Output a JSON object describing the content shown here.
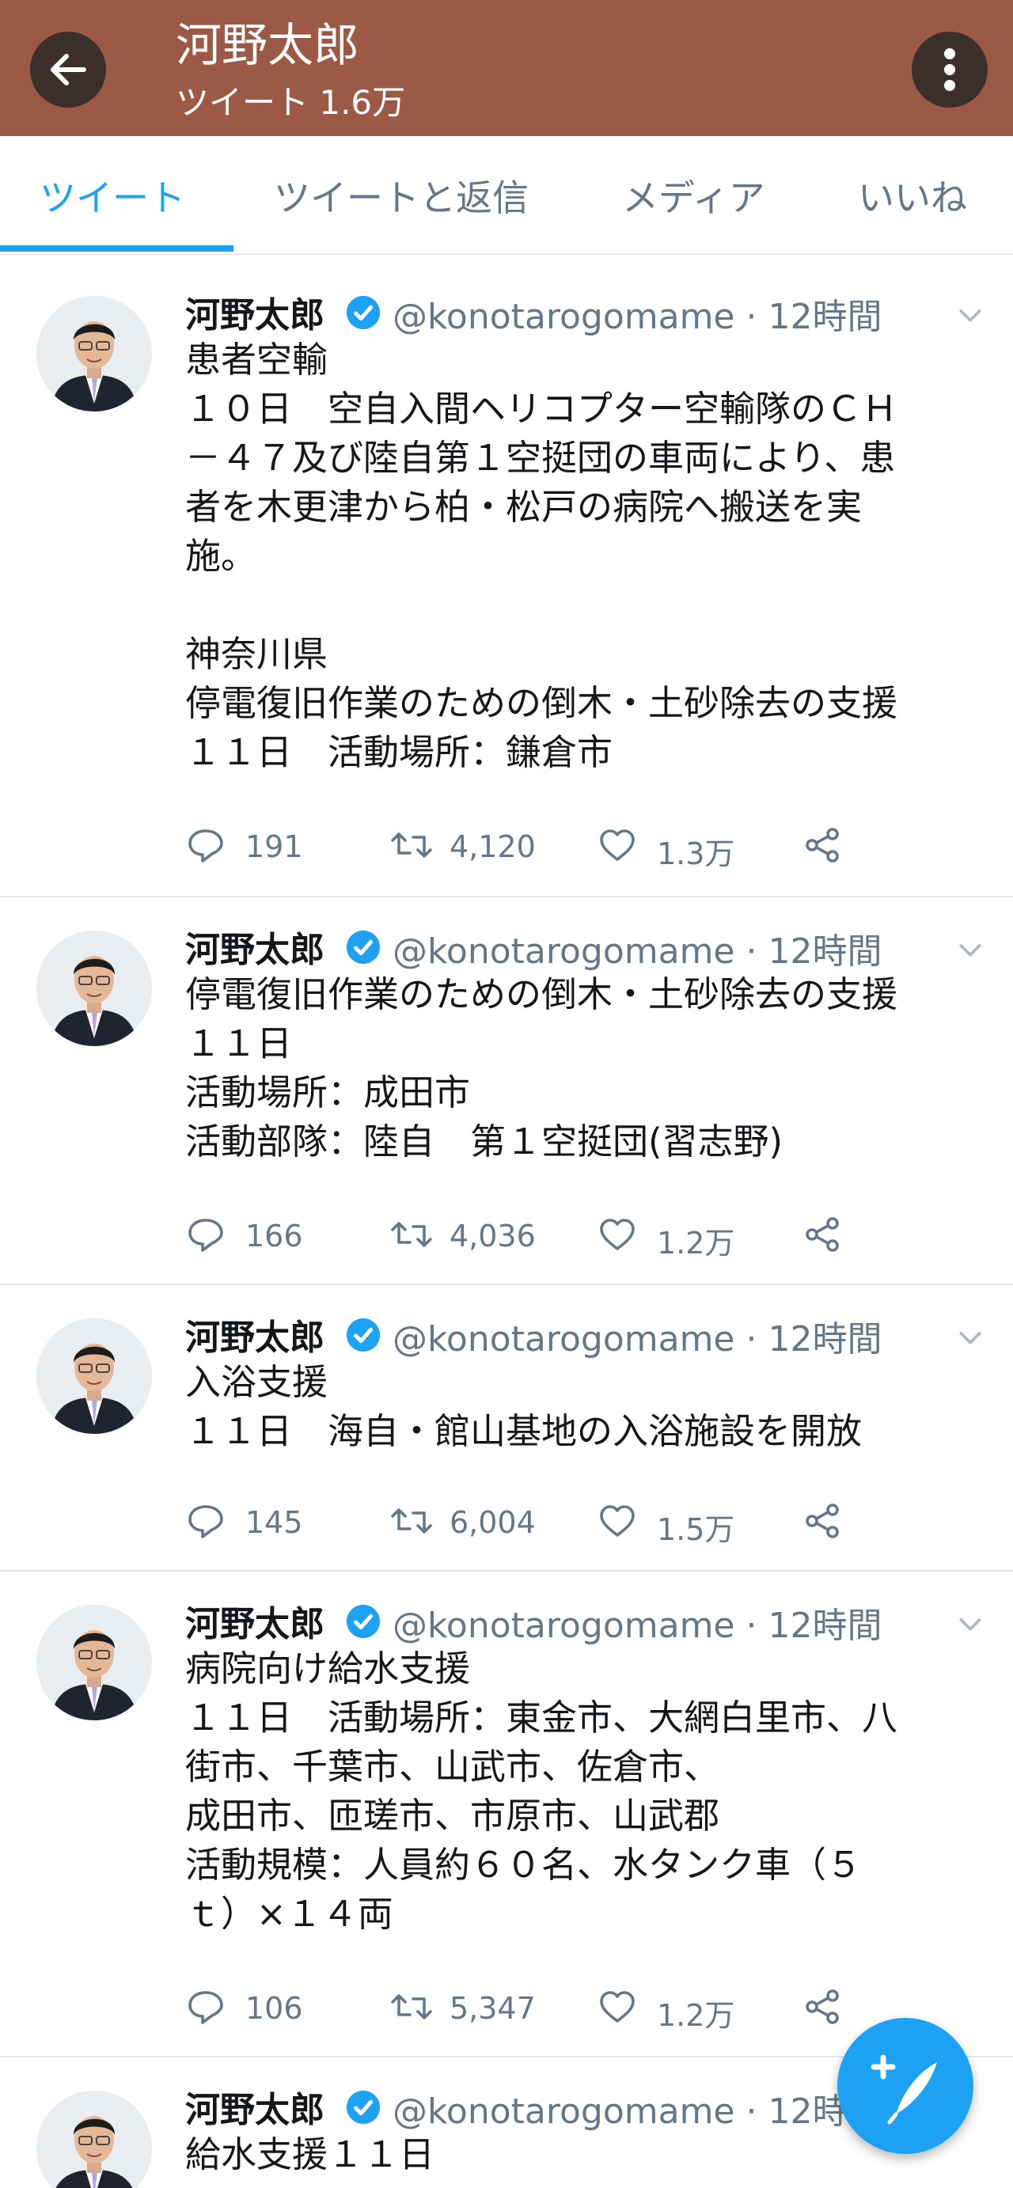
{
  "header": {
    "title": "河野太郎",
    "subtitle": "ツイート 1.6万",
    "bg_color": "#9c5a46"
  },
  "tabs": [
    {
      "label": "ツイート",
      "active": true
    },
    {
      "label": "ツイートと返信",
      "active": false
    },
    {
      "label": "メディア",
      "active": false
    },
    {
      "label": "いいね",
      "active": false
    }
  ],
  "accent_color": "#1da1f2",
  "tweets": [
    {
      "name": "河野太郎",
      "handle": "@konotarogomame · 12時間",
      "text": "患者空輸\n１０日　空自入間ヘリコプター空輸隊のＣＨ\n－４７及び陸自第１空挺団の車両により、患\n者を木更津から柏・松戸の病院へ搬送を実\n施。\n\n神奈川県\n停電復旧作業のための倒木・土砂除去の支援\n１１日　活動場所：鎌倉市",
      "replies": "191",
      "retweets": "4,120",
      "likes": "1.3万"
    },
    {
      "name": "河野太郎",
      "handle": "@konotarogomame · 12時間",
      "text": "停電復旧作業のための倒木・土砂除去の支援\n１１日\n活動場所：成田市\n活動部隊：陸自　第１空挺団(習志野)",
      "replies": "166",
      "retweets": "4,036",
      "likes": "1.2万"
    },
    {
      "name": "河野太郎",
      "handle": "@konotarogomame · 12時間",
      "text": "入浴支援\n１１日　海自・館山基地の入浴施設を開放",
      "replies": "145",
      "retweets": "6,004",
      "likes": "1.5万"
    },
    {
      "name": "河野太郎",
      "handle": "@konotarogomame · 12時間",
      "text": "病院向け給水支援\n１１日　活動場所：東金市、大網白里市、八\n街市、千葉市、山武市、佐倉市、\n成田市、匝瑳市、市原市、山武郡\n活動規模：人員約６０名、水タンク車（５\nｔ）×１４両",
      "replies": "106",
      "retweets": "5,347",
      "likes": "1.2万"
    },
    {
      "name": "河野太郎",
      "handle": "@konotarogomame · 12時",
      "text": "給水支援１１日"
    }
  ]
}
